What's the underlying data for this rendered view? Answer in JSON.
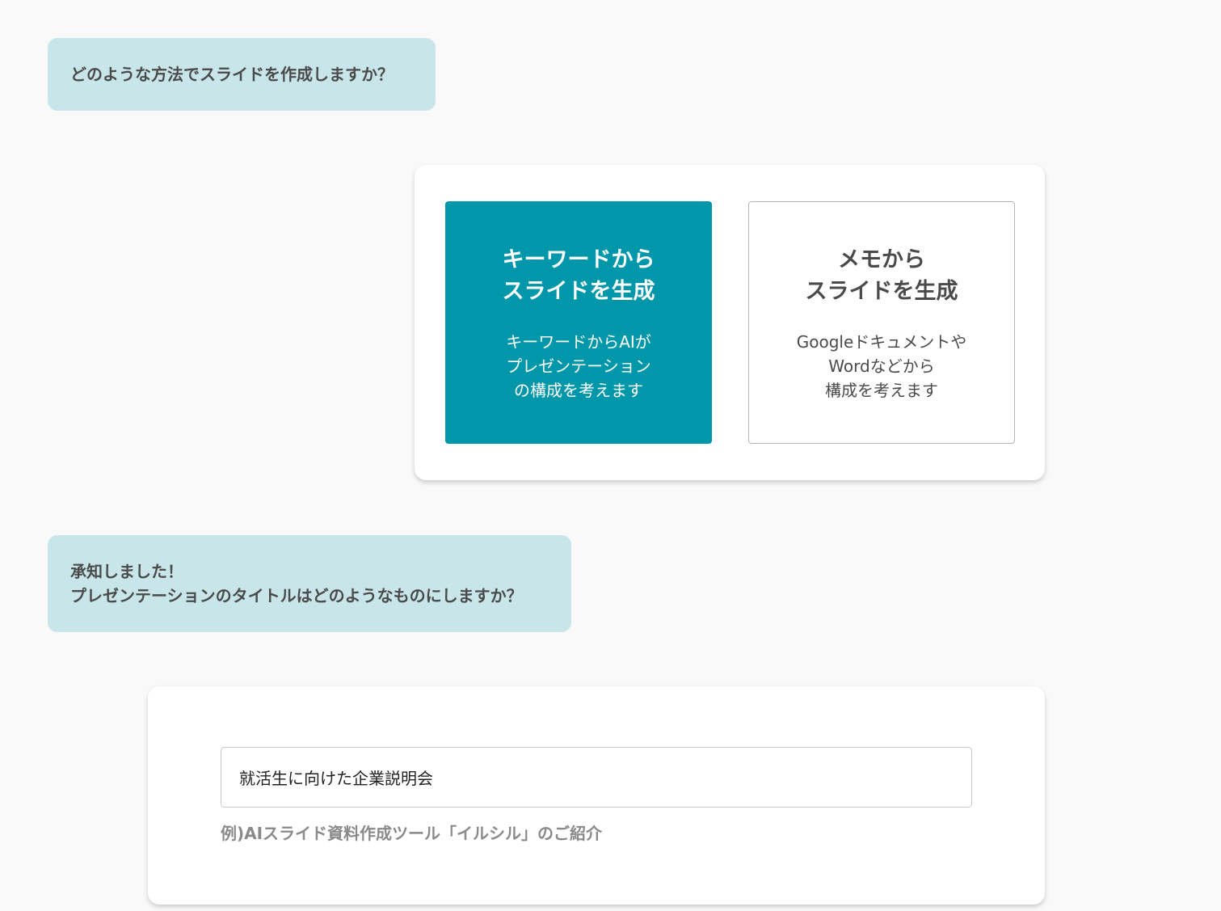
{
  "chat": {
    "question1": "どのような方法でスライドを作成しますか？",
    "reply_line1": "承知しました！",
    "reply_line2": "プレゼンテーションのタイトルはどのようなものにしますか？"
  },
  "options": {
    "keyword": {
      "title_line1": "キーワードから",
      "title_line2": "スライドを生成",
      "desc_line1": "キーワードからAIが",
      "desc_line2": "プレゼンテーション",
      "desc_line3": "の構成を考えます",
      "selected": true
    },
    "memo": {
      "title_line1": "メモから",
      "title_line2": "スライドを生成",
      "desc_line1": "Googleドキュメントや",
      "desc_line2": "Wordなどから",
      "desc_line3": "構成を考えます",
      "selected": false
    }
  },
  "title_form": {
    "input_value": "就活生に向けた企業説明会",
    "example": "例)AIスライド資料作成ツール「イルシル」のご紹介"
  },
  "colors": {
    "bubble_bg": "#c8e6e9",
    "accent": "#0097aa",
    "page_bg": "#f9f9f9"
  }
}
